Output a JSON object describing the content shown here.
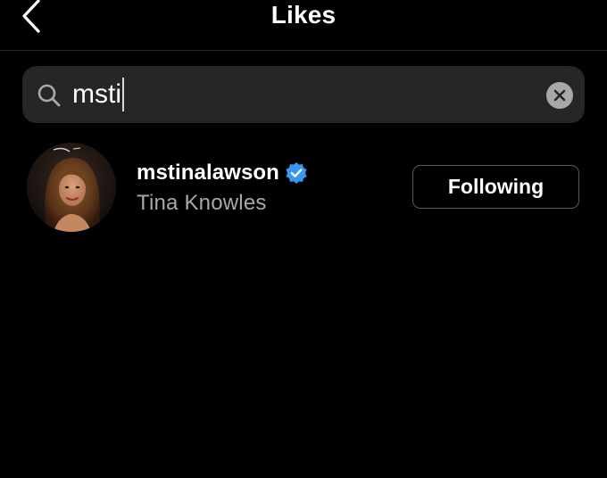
{
  "header": {
    "title": "Likes",
    "back_icon": "chevron-left-icon"
  },
  "search": {
    "value": "msti",
    "search_icon": "search-icon",
    "clear_icon": "close-icon"
  },
  "results": [
    {
      "username": "mstinalawson",
      "full_name": "Tina Knowles",
      "verified": true,
      "button_label": "Following"
    }
  ],
  "colors": {
    "background": "#000000",
    "search_bg": "#262626",
    "secondary_text": "#a8a8a8",
    "verified_blue": "#3897f0",
    "button_border": "#5a5a5a"
  }
}
